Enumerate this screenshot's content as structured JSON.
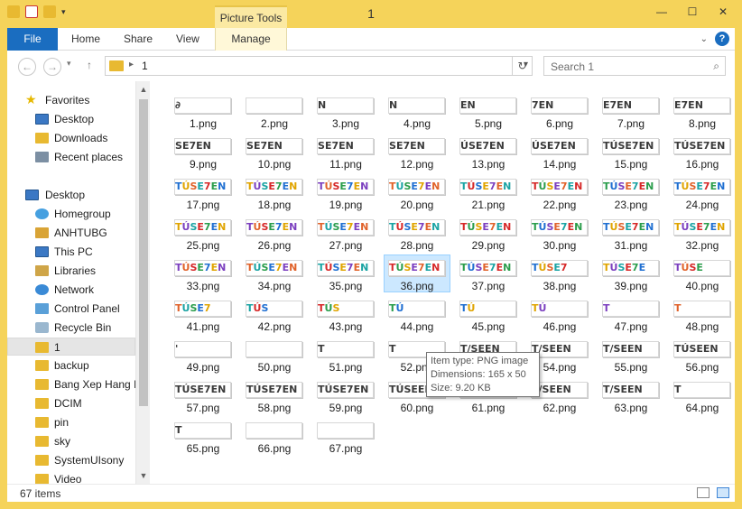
{
  "window": {
    "title": "1",
    "contextual_tab": "Picture Tools",
    "controls": [
      "—",
      "☐",
      "✕"
    ]
  },
  "ribbon": {
    "tabs": [
      "File",
      "Home",
      "Share",
      "View",
      "Manage"
    ],
    "help": "?"
  },
  "navigation": {
    "address": "1",
    "search_placeholder": "Search 1"
  },
  "sidebar": {
    "items": [
      {
        "label": "Favorites",
        "icon": "star-icon"
      },
      {
        "label": "Desktop",
        "icon": "desktop-icon"
      },
      {
        "label": "Downloads",
        "icon": "downloads-icon"
      },
      {
        "label": "Recent places",
        "icon": "recent-places-icon"
      },
      {
        "label": "Desktop",
        "icon": "desktop-icon"
      },
      {
        "label": "Homegroup",
        "icon": "homegroup-icon"
      },
      {
        "label": "ANHTUBG",
        "icon": "user-folder-icon"
      },
      {
        "label": "This PC",
        "icon": "computer-icon"
      },
      {
        "label": "Libraries",
        "icon": "libraries-icon"
      },
      {
        "label": "Network",
        "icon": "network-icon"
      },
      {
        "label": "Control Panel",
        "icon": "control-panel-icon"
      },
      {
        "label": "Recycle Bin",
        "icon": "recycle-bin-icon"
      },
      {
        "label": "1",
        "icon": "folder-icon"
      },
      {
        "label": "backup",
        "icon": "folder-icon"
      },
      {
        "label": "Bang Xep Hang E",
        "icon": "folder-icon"
      },
      {
        "label": "DCIM",
        "icon": "folder-icon"
      },
      {
        "label": "pin",
        "icon": "folder-icon"
      },
      {
        "label": "sky",
        "icon": "folder-icon"
      },
      {
        "label": "SystemUIsony",
        "icon": "folder-icon"
      },
      {
        "label": "Video",
        "icon": "folder-icon"
      }
    ]
  },
  "files": [
    {
      "name": "1.png",
      "thumb": "∂"
    },
    {
      "name": "2.png",
      "thumb": ""
    },
    {
      "name": "3.png",
      "thumb": "N"
    },
    {
      "name": "4.png",
      "thumb": "N"
    },
    {
      "name": "5.png",
      "thumb": "EN"
    },
    {
      "name": "6.png",
      "thumb": "7EN"
    },
    {
      "name": "7.png",
      "thumb": "E7EN"
    },
    {
      "name": "8.png",
      "thumb": "E7EN"
    },
    {
      "name": "9.png",
      "thumb": "SE7EN"
    },
    {
      "name": "10.png",
      "thumb": "SE7EN"
    },
    {
      "name": "11.png",
      "thumb": "SE7EN"
    },
    {
      "name": "12.png",
      "thumb": "SE7EN"
    },
    {
      "name": "13.png",
      "thumb": "Ú SE7EN"
    },
    {
      "name": "14.png",
      "thumb": "Ú SE7EN"
    },
    {
      "name": "15.png",
      "thumb": "TÚ SE7EN"
    },
    {
      "name": "16.png",
      "thumb": "TÚ SE7EN"
    },
    {
      "name": "17.png",
      "thumb": "TÚ SE7EN"
    },
    {
      "name": "18.png",
      "thumb": "TÚ SE7EN"
    },
    {
      "name": "19.png",
      "thumb": "TÚ SE7EN"
    },
    {
      "name": "20.png",
      "thumb": "TÚ SE7EN"
    },
    {
      "name": "21.png",
      "thumb": "TÚ SE7EN"
    },
    {
      "name": "22.png",
      "thumb": "TÚ SE7EN"
    },
    {
      "name": "23.png",
      "thumb": "TÚ SE7EN"
    },
    {
      "name": "24.png",
      "thumb": "TÚ SE7EN"
    },
    {
      "name": "25.png",
      "thumb": "TÚ SE7EN"
    },
    {
      "name": "26.png",
      "thumb": "TÚ SE7EN"
    },
    {
      "name": "27.png",
      "thumb": "TÚ SE7EN"
    },
    {
      "name": "28.png",
      "thumb": "TÚ SE7EN"
    },
    {
      "name": "29.png",
      "thumb": "TÚ SE7EN"
    },
    {
      "name": "30.png",
      "thumb": "TÚ SE7EN"
    },
    {
      "name": "31.png",
      "thumb": "TÚ SE7EN"
    },
    {
      "name": "32.png",
      "thumb": "TÚ SE7EN"
    },
    {
      "name": "33.png",
      "thumb": "TÚ SE7EN"
    },
    {
      "name": "34.png",
      "thumb": "TÚ SE7EN"
    },
    {
      "name": "35.png",
      "thumb": "TÚ SE7EN"
    },
    {
      "name": "36.png",
      "thumb": "TÚ SE7EN"
    },
    {
      "name": "37.png",
      "thumb": "TÚ SE7EN"
    },
    {
      "name": "38.png",
      "thumb": "TÚ SE7"
    },
    {
      "name": "39.png",
      "thumb": "TÚ SE7E"
    },
    {
      "name": "40.png",
      "thumb": "TÚ SE"
    },
    {
      "name": "41.png",
      "thumb": "TÚ SE7"
    },
    {
      "name": "42.png",
      "thumb": "TÚ S"
    },
    {
      "name": "43.png",
      "thumb": "TÚ S"
    },
    {
      "name": "44.png",
      "thumb": "TÚ"
    },
    {
      "name": "45.png",
      "thumb": "TÚ"
    },
    {
      "name": "46.png",
      "thumb": "TÚ"
    },
    {
      "name": "47.png",
      "thumb": "T"
    },
    {
      "name": "48.png",
      "thumb": "T"
    },
    {
      "name": "49.png",
      "thumb": "'"
    },
    {
      "name": "50.png",
      "thumb": ""
    },
    {
      "name": "51.png",
      "thumb": "T"
    },
    {
      "name": "52.png",
      "thumb": "T"
    },
    {
      "name": "53.png",
      "thumb": "T/S E EN"
    },
    {
      "name": "54.png",
      "thumb": "T/S E EN"
    },
    {
      "name": "55.png",
      "thumb": "T/S E EN"
    },
    {
      "name": "56.png",
      "thumb": "TÚSE EN"
    },
    {
      "name": "57.png",
      "thumb": "TÚ SE7EN"
    },
    {
      "name": "58.png",
      "thumb": "TÚ SE7EN"
    },
    {
      "name": "59.png",
      "thumb": "TÚ SE7EN"
    },
    {
      "name": "60.png",
      "thumb": "TÚSE EN"
    },
    {
      "name": "61.png",
      "thumb": "T/S E EN"
    },
    {
      "name": "62.png",
      "thumb": "T/S E EN"
    },
    {
      "name": "63.png",
      "thumb": "T/S E EN"
    },
    {
      "name": "64.png",
      "thumb": "T"
    },
    {
      "name": "65.png",
      "thumb": "T"
    },
    {
      "name": "66.png",
      "thumb": ""
    },
    {
      "name": "67.png",
      "thumb": ""
    }
  ],
  "selected_file": "36.png",
  "tooltip": {
    "line1": "Item type: PNG image",
    "line2": "Dimensions: 165 x 50",
    "line3": "Size: 9.20 KB"
  },
  "status": {
    "count": "67 items"
  },
  "colors": {
    "titlebar": "#f5d35a",
    "file_tab": "#1a6dc0",
    "selection": "#cce8ff"
  }
}
